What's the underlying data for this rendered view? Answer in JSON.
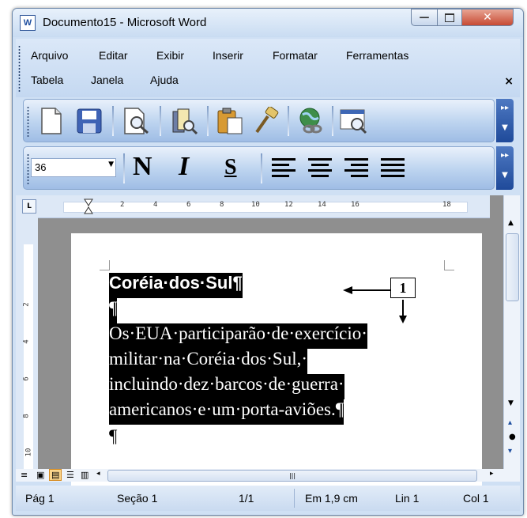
{
  "window": {
    "title": "Documento15 - Microsoft Word",
    "app_icon": "word-doc-icon",
    "controls": [
      "minimize-icon",
      "maximize-icon",
      "close-icon"
    ]
  },
  "menu": {
    "row1": [
      "Arquivo",
      "Editar",
      "Exibir",
      "Inserir",
      "Formatar",
      "Ferramentas"
    ],
    "row2": [
      "Tabela",
      "Janela",
      "Ajuda"
    ],
    "close_glyph": "×"
  },
  "standard_toolbar": {
    "buttons": [
      "new-document-icon",
      "save-icon",
      "print-preview-icon",
      "research-icon",
      "paste-icon",
      "format-painter-icon",
      "hyperlink-icon",
      "drawing-icon"
    ]
  },
  "formatting_toolbar": {
    "font_size": "36",
    "buttons": [
      {
        "name": "bold-button",
        "glyph": "N"
      },
      {
        "name": "italic-button",
        "glyph": "I"
      },
      {
        "name": "underline-button",
        "glyph": "S"
      }
    ],
    "alignments": [
      "align-left-icon",
      "align-center-icon",
      "align-right-icon",
      "justify-icon"
    ]
  },
  "ruler": {
    "h_labels": [
      "2",
      "4",
      "6",
      "8",
      "10",
      "12",
      "14",
      "16",
      "18"
    ],
    "v_labels": [
      "2",
      "4",
      "6",
      "8",
      "10"
    ]
  },
  "document": {
    "heading": "Coréia·dos·Sul¶",
    "empty_para_1": "¶",
    "body_lines": [
      "Os·EUA·participarão·de·exercício·",
      "militar·na·Coréia·dos·Sul,·",
      "incluindo·dez·barcos·de·guerra·",
      "americanos·e·um·porta-aviões.¶"
    ],
    "empty_para_2": "¶"
  },
  "annotation": {
    "label": "1"
  },
  "status": {
    "page": "Pág 1",
    "section": "Seção 1",
    "pages": "1/1",
    "position": "Em 1,9 cm",
    "line": "Lin 1",
    "column": "Col 1"
  },
  "colors": {
    "title_bar": "#c9dcf2",
    "close_button": "#c74a33",
    "toolbar": "#bcd3ef",
    "selection": "#000000"
  }
}
